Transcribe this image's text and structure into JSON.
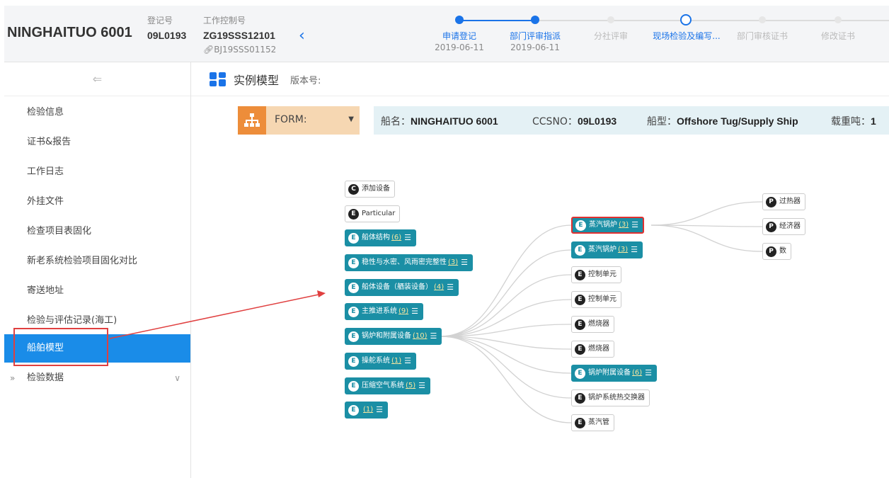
{
  "header": {
    "ship_name": "NINGHAITUO 6001",
    "reg_label": "登记号",
    "reg_value": "09L0193",
    "ctrl_label": "工作控制号",
    "ctrl_value": "ZG19SSS12101",
    "ctrl_sub": "BJ19SSS01152",
    "back_icon": "chevron-left-icon",
    "steps": [
      {
        "label": "申请登记",
        "date": "2019-06-11",
        "state": "done"
      },
      {
        "label": "部门评审指派",
        "date": "2019-06-11",
        "state": "done"
      },
      {
        "label": "分社评审",
        "date": "",
        "state": "pending"
      },
      {
        "label": "现场检验及编写...",
        "date": "",
        "state": "current"
      },
      {
        "label": "部门审核证书",
        "date": "",
        "state": "pending"
      },
      {
        "label": "修改证书",
        "date": "",
        "state": "pending"
      }
    ]
  },
  "sidebar": {
    "collapse_icon": "⇐",
    "items": [
      {
        "label": "检验信息"
      },
      {
        "label": "证书&报告"
      },
      {
        "label": "工作日志"
      },
      {
        "label": "外挂文件"
      },
      {
        "label": "检查项目表固化"
      },
      {
        "label": "新老系统检验项目固化对比"
      },
      {
        "label": "寄送地址"
      },
      {
        "label": "检验与评估记录(海工)"
      },
      {
        "label": "船舶模型",
        "active": true
      },
      {
        "label": "检验数据",
        "expandable": true
      }
    ]
  },
  "content": {
    "title": "实例模型",
    "version_label": "版本号:",
    "form_label": "FORM:",
    "info": {
      "ship_label": "船名：",
      "ship_value": "NINGHAITUO 6001",
      "ccsno_label": "CCSNO：",
      "ccsno_value": "09L0193",
      "type_label": "船型：",
      "type_value": "Offshore Tug/Supply Ship",
      "dwt_label": "载重吨：",
      "dwt_value": "1"
    }
  },
  "tree": {
    "left": [
      {
        "badge": "C",
        "text": "添加设备",
        "style": "white"
      },
      {
        "badge": "E",
        "text": "Particular",
        "style": "white"
      },
      {
        "badge": "E",
        "text": "船体结构",
        "count": "(6)",
        "style": "teal",
        "list": true
      },
      {
        "badge": "E",
        "text": "稳性与水密、风雨密完整性",
        "count": "(3)",
        "style": "teal",
        "list": true
      },
      {
        "badge": "E",
        "text": "船体设备（舾装设备）",
        "count": "(4)",
        "style": "teal",
        "list": true
      },
      {
        "badge": "E",
        "text": "主推进系统",
        "count": "(9)",
        "style": "teal",
        "list": true
      },
      {
        "badge": "E",
        "text": "锅炉和附属设备",
        "count": "(10)",
        "style": "teal",
        "list": true
      },
      {
        "badge": "E",
        "text": "操舵系统",
        "count": "(1)",
        "style": "teal",
        "list": true
      },
      {
        "badge": "E",
        "text": "压缩空气系统",
        "count": "(5)",
        "style": "teal",
        "list": true
      },
      {
        "badge": "E",
        "text": "",
        "count": "(1)",
        "style": "teal",
        "list": true
      }
    ],
    "middle": [
      {
        "badge": "E",
        "text": "蒸汽锅炉",
        "count": "(3)",
        "style": "teal",
        "list": true,
        "selected": true
      },
      {
        "badge": "E",
        "text": "蒸汽锅炉",
        "count": "(3)",
        "style": "teal",
        "list": true
      },
      {
        "badge": "E",
        "text": "控制单元",
        "style": "white"
      },
      {
        "badge": "E",
        "text": "控制单元",
        "style": "white"
      },
      {
        "badge": "E",
        "text": "燃烧器",
        "style": "white"
      },
      {
        "badge": "E",
        "text": "燃烧器",
        "style": "white"
      },
      {
        "badge": "E",
        "text": "锅炉附属设备",
        "count": "(6)",
        "style": "teal",
        "list": true
      },
      {
        "badge": "E",
        "text": "锅炉系统热交换器",
        "style": "white"
      },
      {
        "badge": "E",
        "text": "蒸汽管",
        "style": "white"
      }
    ],
    "right": [
      {
        "badge": "P",
        "text": "过热器",
        "style": "white"
      },
      {
        "badge": "P",
        "text": "经济器",
        "style": "white"
      },
      {
        "badge": "P",
        "text": "数",
        "style": "white"
      }
    ]
  },
  "colors": {
    "accent": "#1a73e8",
    "teal": "#1b8fa5",
    "active": "#1a8ce8",
    "highlight": "#e04040",
    "form": "#ed8d3a"
  }
}
